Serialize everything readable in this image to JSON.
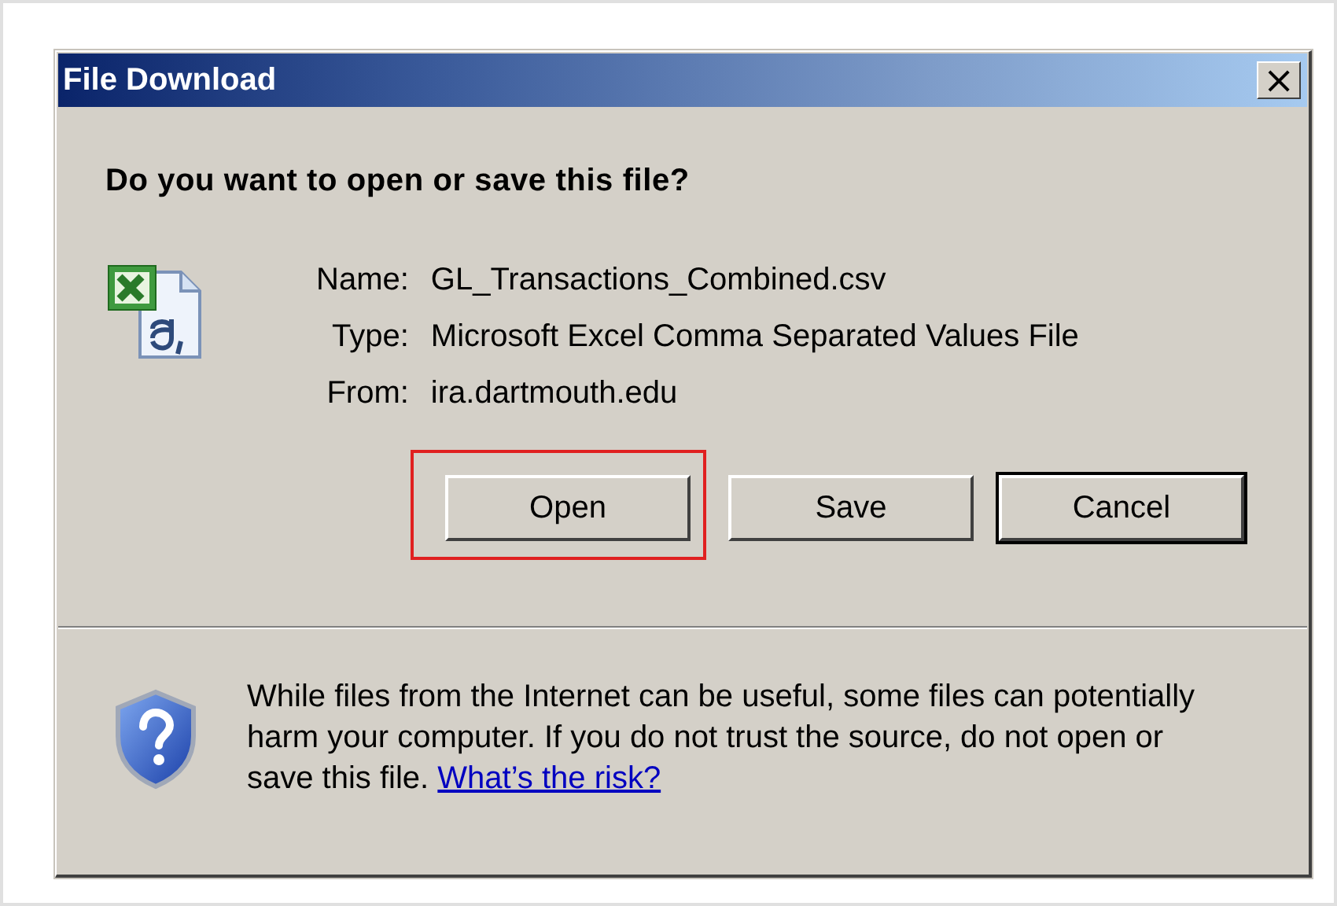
{
  "window": {
    "title": "File Download",
    "close_glyph": "×"
  },
  "question": "Do you want to open or save this file?",
  "file_info": [
    {
      "label": "Name:",
      "value": "GL_Transactions_Combined.csv"
    },
    {
      "label": "Type:",
      "value": "Microsoft Excel Comma Separated Values File"
    },
    {
      "label": "From:",
      "value": "ira.dartmouth.edu"
    }
  ],
  "buttons": [
    {
      "label": "Open",
      "highlighted": true,
      "default": false
    },
    {
      "label": "Save",
      "highlighted": false,
      "default": false
    },
    {
      "label": "Cancel",
      "highlighted": false,
      "default": true
    }
  ],
  "warning": {
    "text": "While files from the Internet can be useful, some files can potentially harm your computer. If you do not trust the source, do not open or save this file.",
    "link": "What’s the risk?"
  }
}
